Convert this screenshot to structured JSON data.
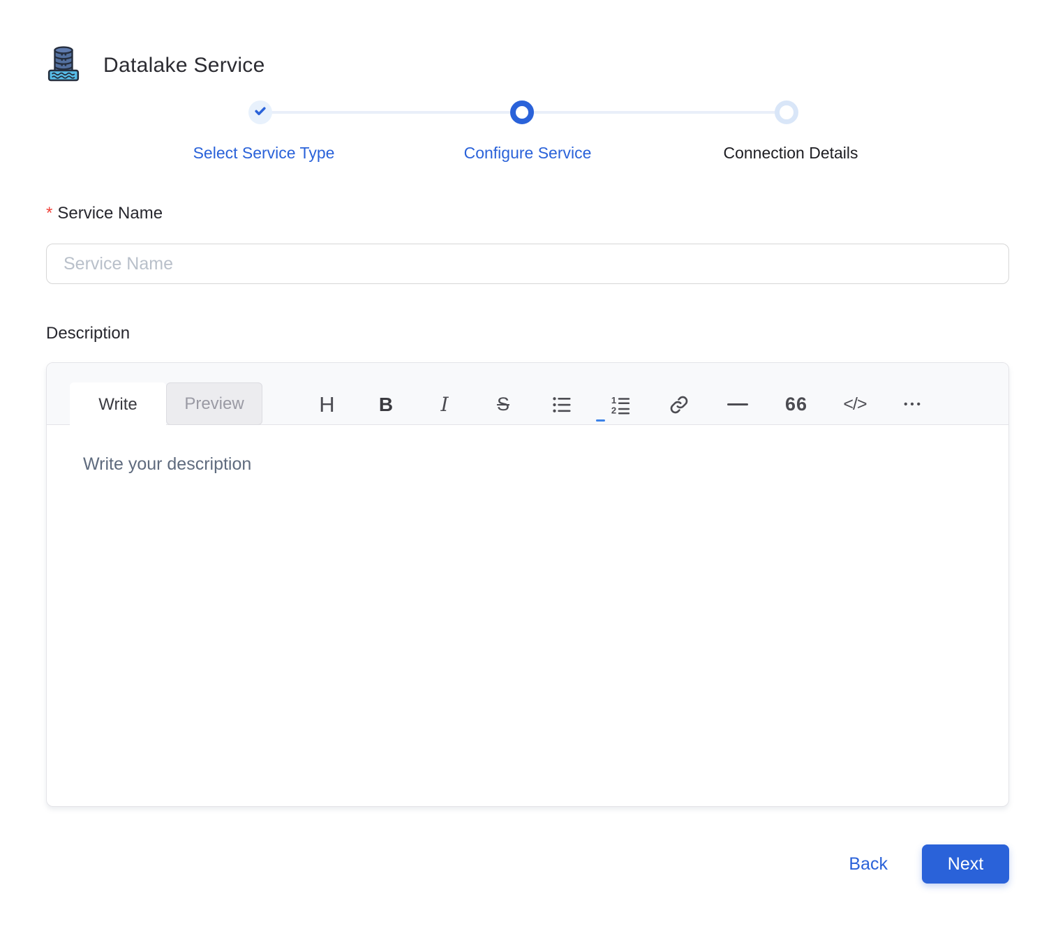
{
  "header": {
    "title": "Datalake Service"
  },
  "stepper": {
    "steps": [
      {
        "label": "Select Service Type",
        "state": "completed"
      },
      {
        "label": "Configure Service",
        "state": "active"
      },
      {
        "label": "Connection Details",
        "state": "upcoming"
      }
    ]
  },
  "form": {
    "service_name": {
      "label": "Service Name",
      "required_marker": "*",
      "placeholder": "Service Name",
      "value": ""
    },
    "description": {
      "label": "Description",
      "tabs": {
        "write": "Write",
        "preview": "Preview"
      },
      "toolbar": {
        "heading": "H",
        "bold": "B",
        "italic": "I",
        "strikethrough": "S",
        "quote": "66",
        "code": "</>",
        "more": "•••"
      },
      "placeholder": "Write your description",
      "value": ""
    }
  },
  "footer": {
    "back": "Back",
    "next": "Next"
  },
  "colors": {
    "primary": "#2a62d9",
    "step_line": "#e9eff9",
    "completed_step_bg": "#e8f1fc",
    "upcoming_ring": "#d9e6f8",
    "required": "#f0443c",
    "editor_header_bg": "#f8f9fb"
  }
}
